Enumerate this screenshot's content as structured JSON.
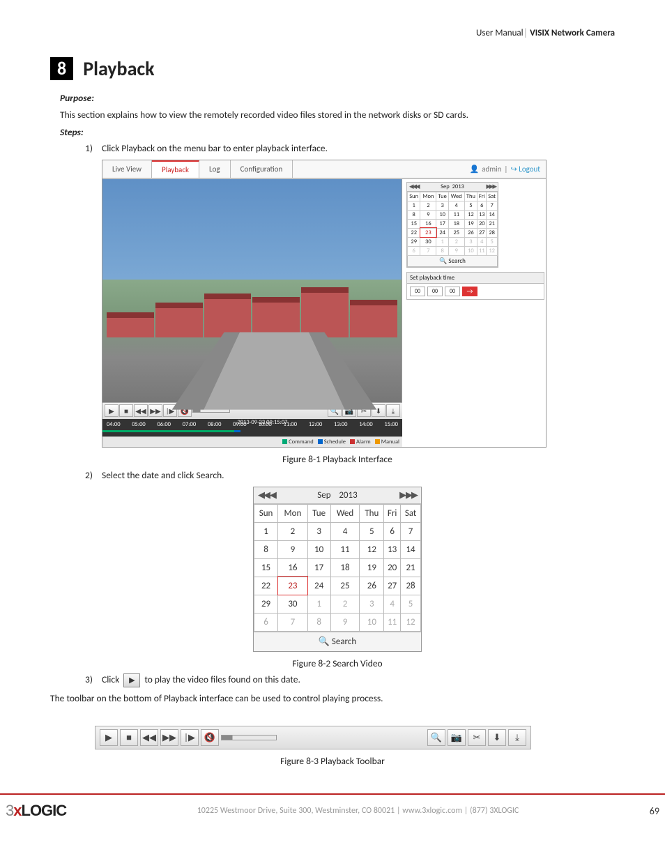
{
  "header": {
    "left": "User Manual",
    "bar": "│",
    "right": "VISIX Network Camera"
  },
  "chapter": {
    "num": "8",
    "title": "Playback"
  },
  "purpose_label": "Purpose:",
  "purpose_text": "This section explains how to view the remotely recorded video files stored in the network disks or SD cards.",
  "steps_label": "Steps:",
  "steps": [
    {
      "n": "1)",
      "text": "Click Playback on the menu bar to enter playback interface."
    },
    {
      "n": "2)",
      "text": "Select the date and click Search."
    },
    {
      "n": "3)",
      "pre": "Click",
      "post": "to play the video files found on this date."
    }
  ],
  "toolbar_note": "The toolbar on the bottom of Playback interface can be used to control playing process.",
  "captions": {
    "f81": "Figure 8-1 Playback Interface",
    "f82": "Figure 8-2 Search Video",
    "f83": "Figure 8-3 Playback Toolbar"
  },
  "ui": {
    "tabs": [
      "Live View",
      "Playback",
      "Log",
      "Configuration"
    ],
    "user": "admin",
    "logout": "Logout",
    "month": "Sep",
    "year": "2013",
    "dow": [
      "Sun",
      "Mon",
      "Tue",
      "Wed",
      "Thu",
      "Fri",
      "Sat"
    ],
    "weeks": [
      [
        "1",
        "2",
        "3",
        "4",
        "5",
        "6",
        "7"
      ],
      [
        "8",
        "9",
        "10",
        "11",
        "12",
        "13",
        "14"
      ],
      [
        "15",
        "16",
        "17",
        "18",
        "19",
        "20",
        "21"
      ],
      [
        "22",
        "23",
        "24",
        "25",
        "26",
        "27",
        "28"
      ],
      [
        "29",
        "30",
        "1",
        "2",
        "3",
        "4",
        "5"
      ],
      [
        "6",
        "7",
        "8",
        "9",
        "10",
        "11",
        "12"
      ]
    ],
    "selected": "23",
    "gray_start": 30,
    "search": "Search",
    "timestamp": "2013-09-23 09:15:07",
    "ticks": [
      "04:00",
      "05:00",
      "06:00",
      "07:00",
      "08:00",
      "09:00",
      "10:00",
      "11:00",
      "12:00",
      "13:00",
      "14:00",
      "15:00"
    ],
    "legend": [
      {
        "c": "#0a7",
        "t": "Command"
      },
      {
        "c": "#06c",
        "t": "Schedule"
      },
      {
        "c": "#c33",
        "t": "Alarm"
      },
      {
        "c": "#e90",
        "t": "Manual"
      }
    ],
    "setpb": "Set playback time",
    "time": [
      "00",
      "00",
      "00"
    ]
  },
  "footer": {
    "addr": "10225 Westmoor Drive, Suite 300, Westminster, CO 80021 | www.3xlogic.com | (877) 3XLOGIC",
    "page": "69"
  }
}
